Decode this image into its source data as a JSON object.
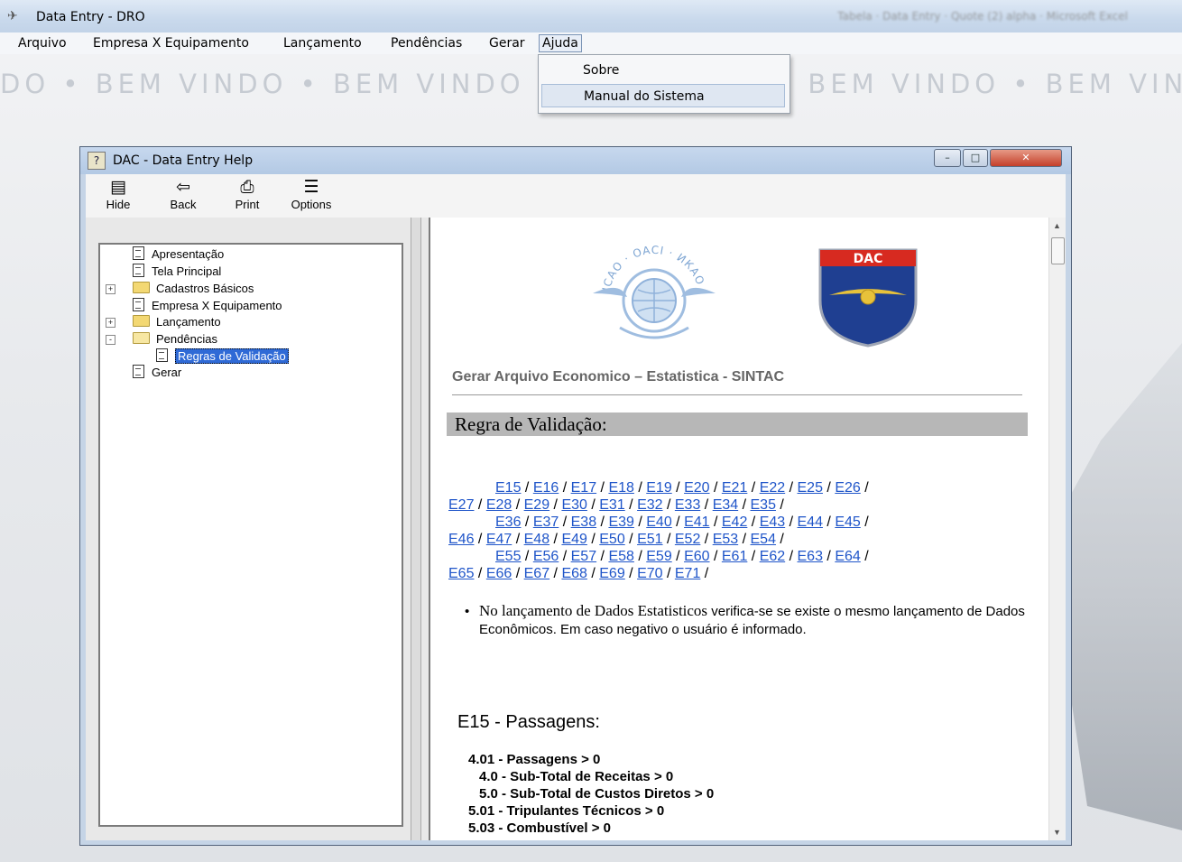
{
  "app": {
    "title": "Data Entry - DRO",
    "title_right_blurred": "Tabela · Data Entry · Quote (2) alpha · Microsoft Excel",
    "menu": [
      "Arquivo",
      "Empresa X Equipamento",
      "Lançamento",
      "Pendências",
      "Gerar",
      "Ajuda"
    ],
    "welcome_marquee": "DO • BEM VINDO • BEM VINDO • BEM VINDO • BEM VINDO • BEM VINDO"
  },
  "dropdown": {
    "items": [
      "Sobre",
      "Manual do Sistema"
    ],
    "hovered_index": 1
  },
  "help_window": {
    "title": "DAC - Data Entry Help",
    "toolbar": [
      {
        "label": "Hide",
        "icon": "hide-icon"
      },
      {
        "label": "Back",
        "icon": "back-arrow-icon"
      },
      {
        "label": "Print",
        "icon": "printer-icon"
      },
      {
        "label": "Options",
        "icon": "options-icon"
      }
    ],
    "toc": [
      {
        "label": "Apresentação",
        "type": "page"
      },
      {
        "label": "Tela Principal",
        "type": "page"
      },
      {
        "label": "Cadastros Básicos",
        "type": "folder",
        "expander": "+"
      },
      {
        "label": "Empresa X Equipamento",
        "type": "page"
      },
      {
        "label": "Lançamento",
        "type": "folder",
        "expander": "+"
      },
      {
        "label": "Pendências",
        "type": "folder-open",
        "expander": "-"
      },
      {
        "label": "Regras de Validação",
        "type": "page",
        "selected": true
      },
      {
        "label": "Gerar",
        "type": "page"
      }
    ],
    "content": {
      "logo_icao_text": "ICAO · OACI · ИКАО",
      "logo_dac_text": "DAC",
      "heading": "Gerar Arquivo Economico – Estatistica - SINTAC",
      "section_title": "Regra de Validação:",
      "code_rows": [
        [
          "E15",
          "E16",
          "E17",
          "E18",
          "E19",
          "E20",
          "E21",
          "E22",
          "E25",
          "E26"
        ],
        [
          "E27",
          "E28",
          "E29",
          "E30",
          "E31",
          "E32",
          "E33",
          "E34",
          "E35"
        ],
        [
          "E36",
          "E37",
          "E38",
          "E39",
          "E40",
          "E41",
          "E42",
          "E43",
          "E44",
          "E45"
        ],
        [
          "E46",
          "E47",
          "E48",
          "E49",
          "E50",
          "E51",
          "E52",
          "E53",
          "E54"
        ],
        [
          "E55",
          "E56",
          "E57",
          "E58",
          "E59",
          "E60",
          "E61",
          "E62",
          "E63",
          "E64"
        ],
        [
          "E65",
          "E66",
          "E67",
          "E68",
          "E69",
          "E70",
          "E71"
        ]
      ],
      "bullet_lead": "No lançamento de Dados Estatisticos",
      "bullet_rest": " verifica-se se existe o mesmo lançamento de Dados Econômicos. Em caso negativo o usuário é informado.",
      "e15_title": "E15 - Passagens:",
      "e15_rules": [
        "4.01 - Passagens > 0",
        "4.0 - Sub-Total de Receitas > 0",
        "5.0 - Sub-Total de Custos Diretos > 0",
        "5.01 - Tripulantes Técnicos > 0",
        "5.03 - Combustível > 0"
      ]
    }
  }
}
